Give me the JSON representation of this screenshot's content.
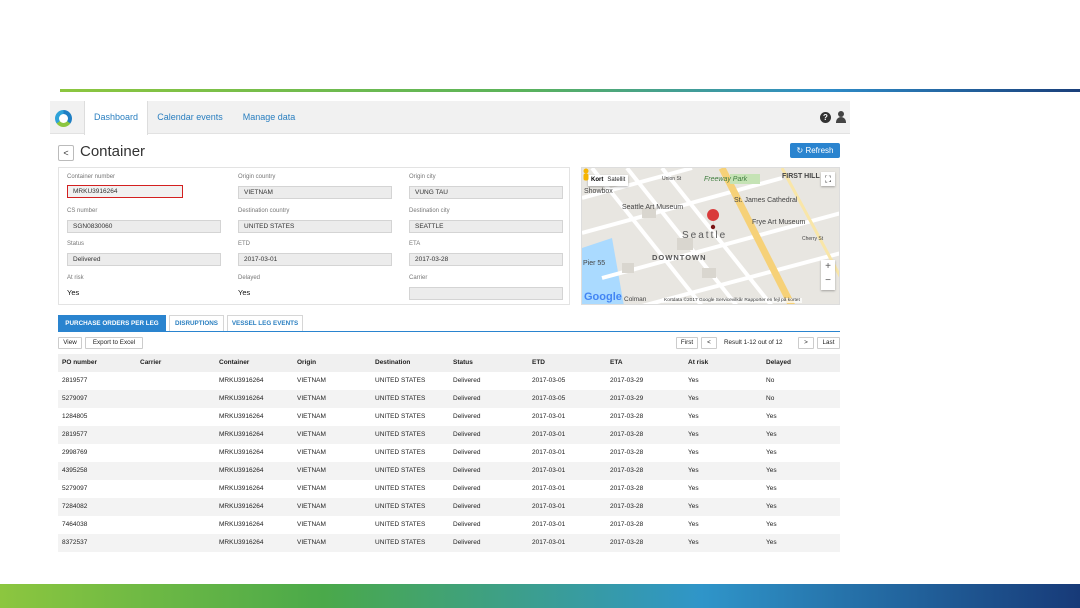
{
  "nav": {
    "tabs": [
      {
        "label": "Dashboard"
      },
      {
        "label": "Calendar events"
      },
      {
        "label": "Manage data"
      }
    ]
  },
  "header": {
    "back_label": "<",
    "title": "Container",
    "refresh_label": "Refresh"
  },
  "details": {
    "container_number_label": "Container number",
    "container_number": "MRKU3916264",
    "origin_country_label": "Origin country",
    "origin_country": "VIETNAM",
    "origin_city_label": "Origin city",
    "origin_city": "VUNG TAU",
    "cs_number_label": "CS number",
    "cs_number": "SGN0830060",
    "dest_country_label": "Destination country",
    "dest_country": "UNITED STATES",
    "dest_city_label": "Destination city",
    "dest_city": "SEATTLE",
    "status_label": "Status",
    "status": "Delivered",
    "etd_label": "ETD",
    "etd": "2017-03-01",
    "eta_label": "ETA",
    "eta": "2017-03-28",
    "at_risk_label": "At risk",
    "at_risk": "Yes",
    "delayed_label": "Delayed",
    "delayed": "Yes",
    "carrier_label": "Carrier",
    "carrier": ""
  },
  "map": {
    "toggle_map": "Kort",
    "toggle_sat": "Satellit",
    "labels": {
      "freeway_park": "Freeway Park",
      "first_hill": "FIRST HILL",
      "union_st": "Union St",
      "seattle_art_museum": "Seattle Art Museum",
      "st_james": "St. James Cathedral",
      "frye": "Frye Art Museum",
      "seattle": "Seattle",
      "downtown": "DOWNTOWN",
      "pier": "Pier 55",
      "cherry": "Cherry St",
      "showbox": "Showbox",
      "colman": "Colman"
    },
    "google": "Google",
    "credits": "Kortdata ©2017 Google   Servicevilkår   Rapporter en fejl på kortet"
  },
  "subtabs": [
    {
      "label": "PURCHASE ORDERS PER LEG"
    },
    {
      "label": "DISRUPTIONS"
    },
    {
      "label": "VESSEL LEG EVENTS"
    }
  ],
  "toolbar": {
    "view_label": "View",
    "export_label": "Export to Excel",
    "first_label": "First",
    "prev_label": "<",
    "result_text": "Result 1-12 out of 12",
    "next_label": ">",
    "last_label": "Last"
  },
  "table": {
    "columns": [
      "PO number",
      "Carrier",
      "Container",
      "Origin",
      "Destination",
      "Status",
      "ETD",
      "ETA",
      "At risk",
      "Delayed"
    ],
    "rows": [
      [
        "2819577",
        "",
        "MRKU3916264",
        "VIETNAM",
        "UNITED STATES",
        "Delivered",
        "2017-03-05",
        "2017-03-29",
        "Yes",
        "No"
      ],
      [
        "5279097",
        "",
        "MRKU3916264",
        "VIETNAM",
        "UNITED STATES",
        "Delivered",
        "2017-03-05",
        "2017-03-29",
        "Yes",
        "No"
      ],
      [
        "1284805",
        "",
        "MRKU3916264",
        "VIETNAM",
        "UNITED STATES",
        "Delivered",
        "2017-03-01",
        "2017-03-28",
        "Yes",
        "Yes"
      ],
      [
        "2819577",
        "",
        "MRKU3916264",
        "VIETNAM",
        "UNITED STATES",
        "Delivered",
        "2017-03-01",
        "2017-03-28",
        "Yes",
        "Yes"
      ],
      [
        "2998769",
        "",
        "MRKU3916264",
        "VIETNAM",
        "UNITED STATES",
        "Delivered",
        "2017-03-01",
        "2017-03-28",
        "Yes",
        "Yes"
      ],
      [
        "4395258",
        "",
        "MRKU3916264",
        "VIETNAM",
        "UNITED STATES",
        "Delivered",
        "2017-03-01",
        "2017-03-28",
        "Yes",
        "Yes"
      ],
      [
        "5279097",
        "",
        "MRKU3916264",
        "VIETNAM",
        "UNITED STATES",
        "Delivered",
        "2017-03-01",
        "2017-03-28",
        "Yes",
        "Yes"
      ],
      [
        "7284082",
        "",
        "MRKU3916264",
        "VIETNAM",
        "UNITED STATES",
        "Delivered",
        "2017-03-01",
        "2017-03-28",
        "Yes",
        "Yes"
      ],
      [
        "7464038",
        "",
        "MRKU3916264",
        "VIETNAM",
        "UNITED STATES",
        "Delivered",
        "2017-03-01",
        "2017-03-28",
        "Yes",
        "Yes"
      ],
      [
        "8372537",
        "",
        "MRKU3916264",
        "VIETNAM",
        "UNITED STATES",
        "Delivered",
        "2017-03-01",
        "2017-03-28",
        "Yes",
        "Yes"
      ]
    ]
  },
  "colors": {
    "accent": "#2a84cf",
    "highlight_border": "#d32020"
  }
}
